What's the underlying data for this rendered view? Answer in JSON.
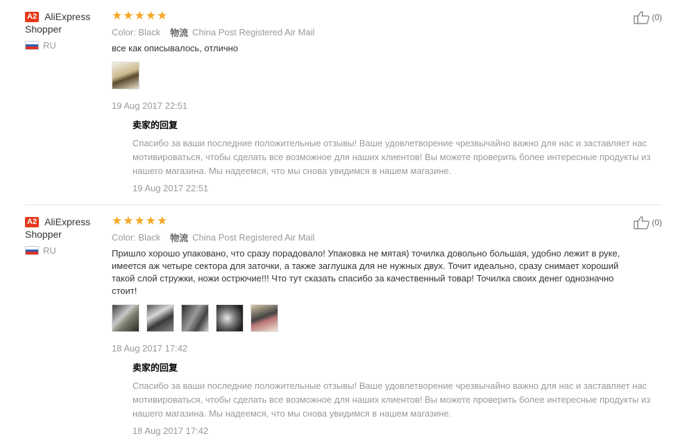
{
  "reviews": [
    {
      "buyer_level": "A2",
      "buyer_name_line1": "AliExpress",
      "buyer_name_line2": "Shopper",
      "country": "RU",
      "rating": 5,
      "color_label": "Color:",
      "color_value": "Black",
      "shipping_label": "物流",
      "shipping_value": "China Post Registered Air Mail",
      "text": "все как описывалось, отлично",
      "photos": [
        "photo-1"
      ],
      "date": "19 Aug 2017 22:51",
      "reply_title": "卖家的回复",
      "reply_text": "Спасибо за ваши последние положительные отзывы! Ваше удовлетворение чрезвычайно важно для нас и заставляет нас мотивироваться, чтобы сделать все возможное для наших клиентов! Вы можете проверить более интересные продукты из нашего магазина. Мы надеемся, что мы снова увидимся в нашем магазине.",
      "reply_date": "19 Aug 2017 22:51",
      "helpful_count": "(0)"
    },
    {
      "buyer_level": "A2",
      "buyer_name_line1": "AliExpress",
      "buyer_name_line2": "Shopper",
      "country": "RU",
      "rating": 5,
      "color_label": "Color:",
      "color_value": "Black",
      "shipping_label": "物流",
      "shipping_value": "China Post Registered Air Mail",
      "text": "Пришло хорошо упаковано, что сразу порадовало! Упаковка не мятая) точилка довольно большая, удобно лежит в руке, имеется аж четыре сектора для заточки, а также заглушка для не нужных двух. Точит идеально, сразу снимает хороший такой слой стружки, ножи острючие!!! Что тут сказать спасибо за качественный товар! Точилка своих денег однозначно стоит!",
      "photos": [
        "photo-1",
        "photo-2",
        "photo-3",
        "photo-4",
        "photo-5"
      ],
      "date": "18 Aug 2017 17:42",
      "reply_title": "卖家的回复",
      "reply_text": "Спасибо за ваши последние положительные отзывы! Ваше удовлетворение чрезвычайно важно для нас и заставляет нас мотивироваться, чтобы сделать все возможное для наших клиентов! Вы можете проверить более интересные продукты из нашего магазина. Мы надеемся, что мы снова увидимся в нашем магазине.",
      "reply_date": "18 Aug 2017 17:42",
      "helpful_count": "(0)"
    }
  ],
  "colors": {
    "star": "#f5a623",
    "badge": "#e5391b",
    "muted_text": "#999999"
  },
  "icons": {
    "helpful": "thumbs-up-icon",
    "star": "star-icon",
    "flag": "russia-flag-icon"
  }
}
